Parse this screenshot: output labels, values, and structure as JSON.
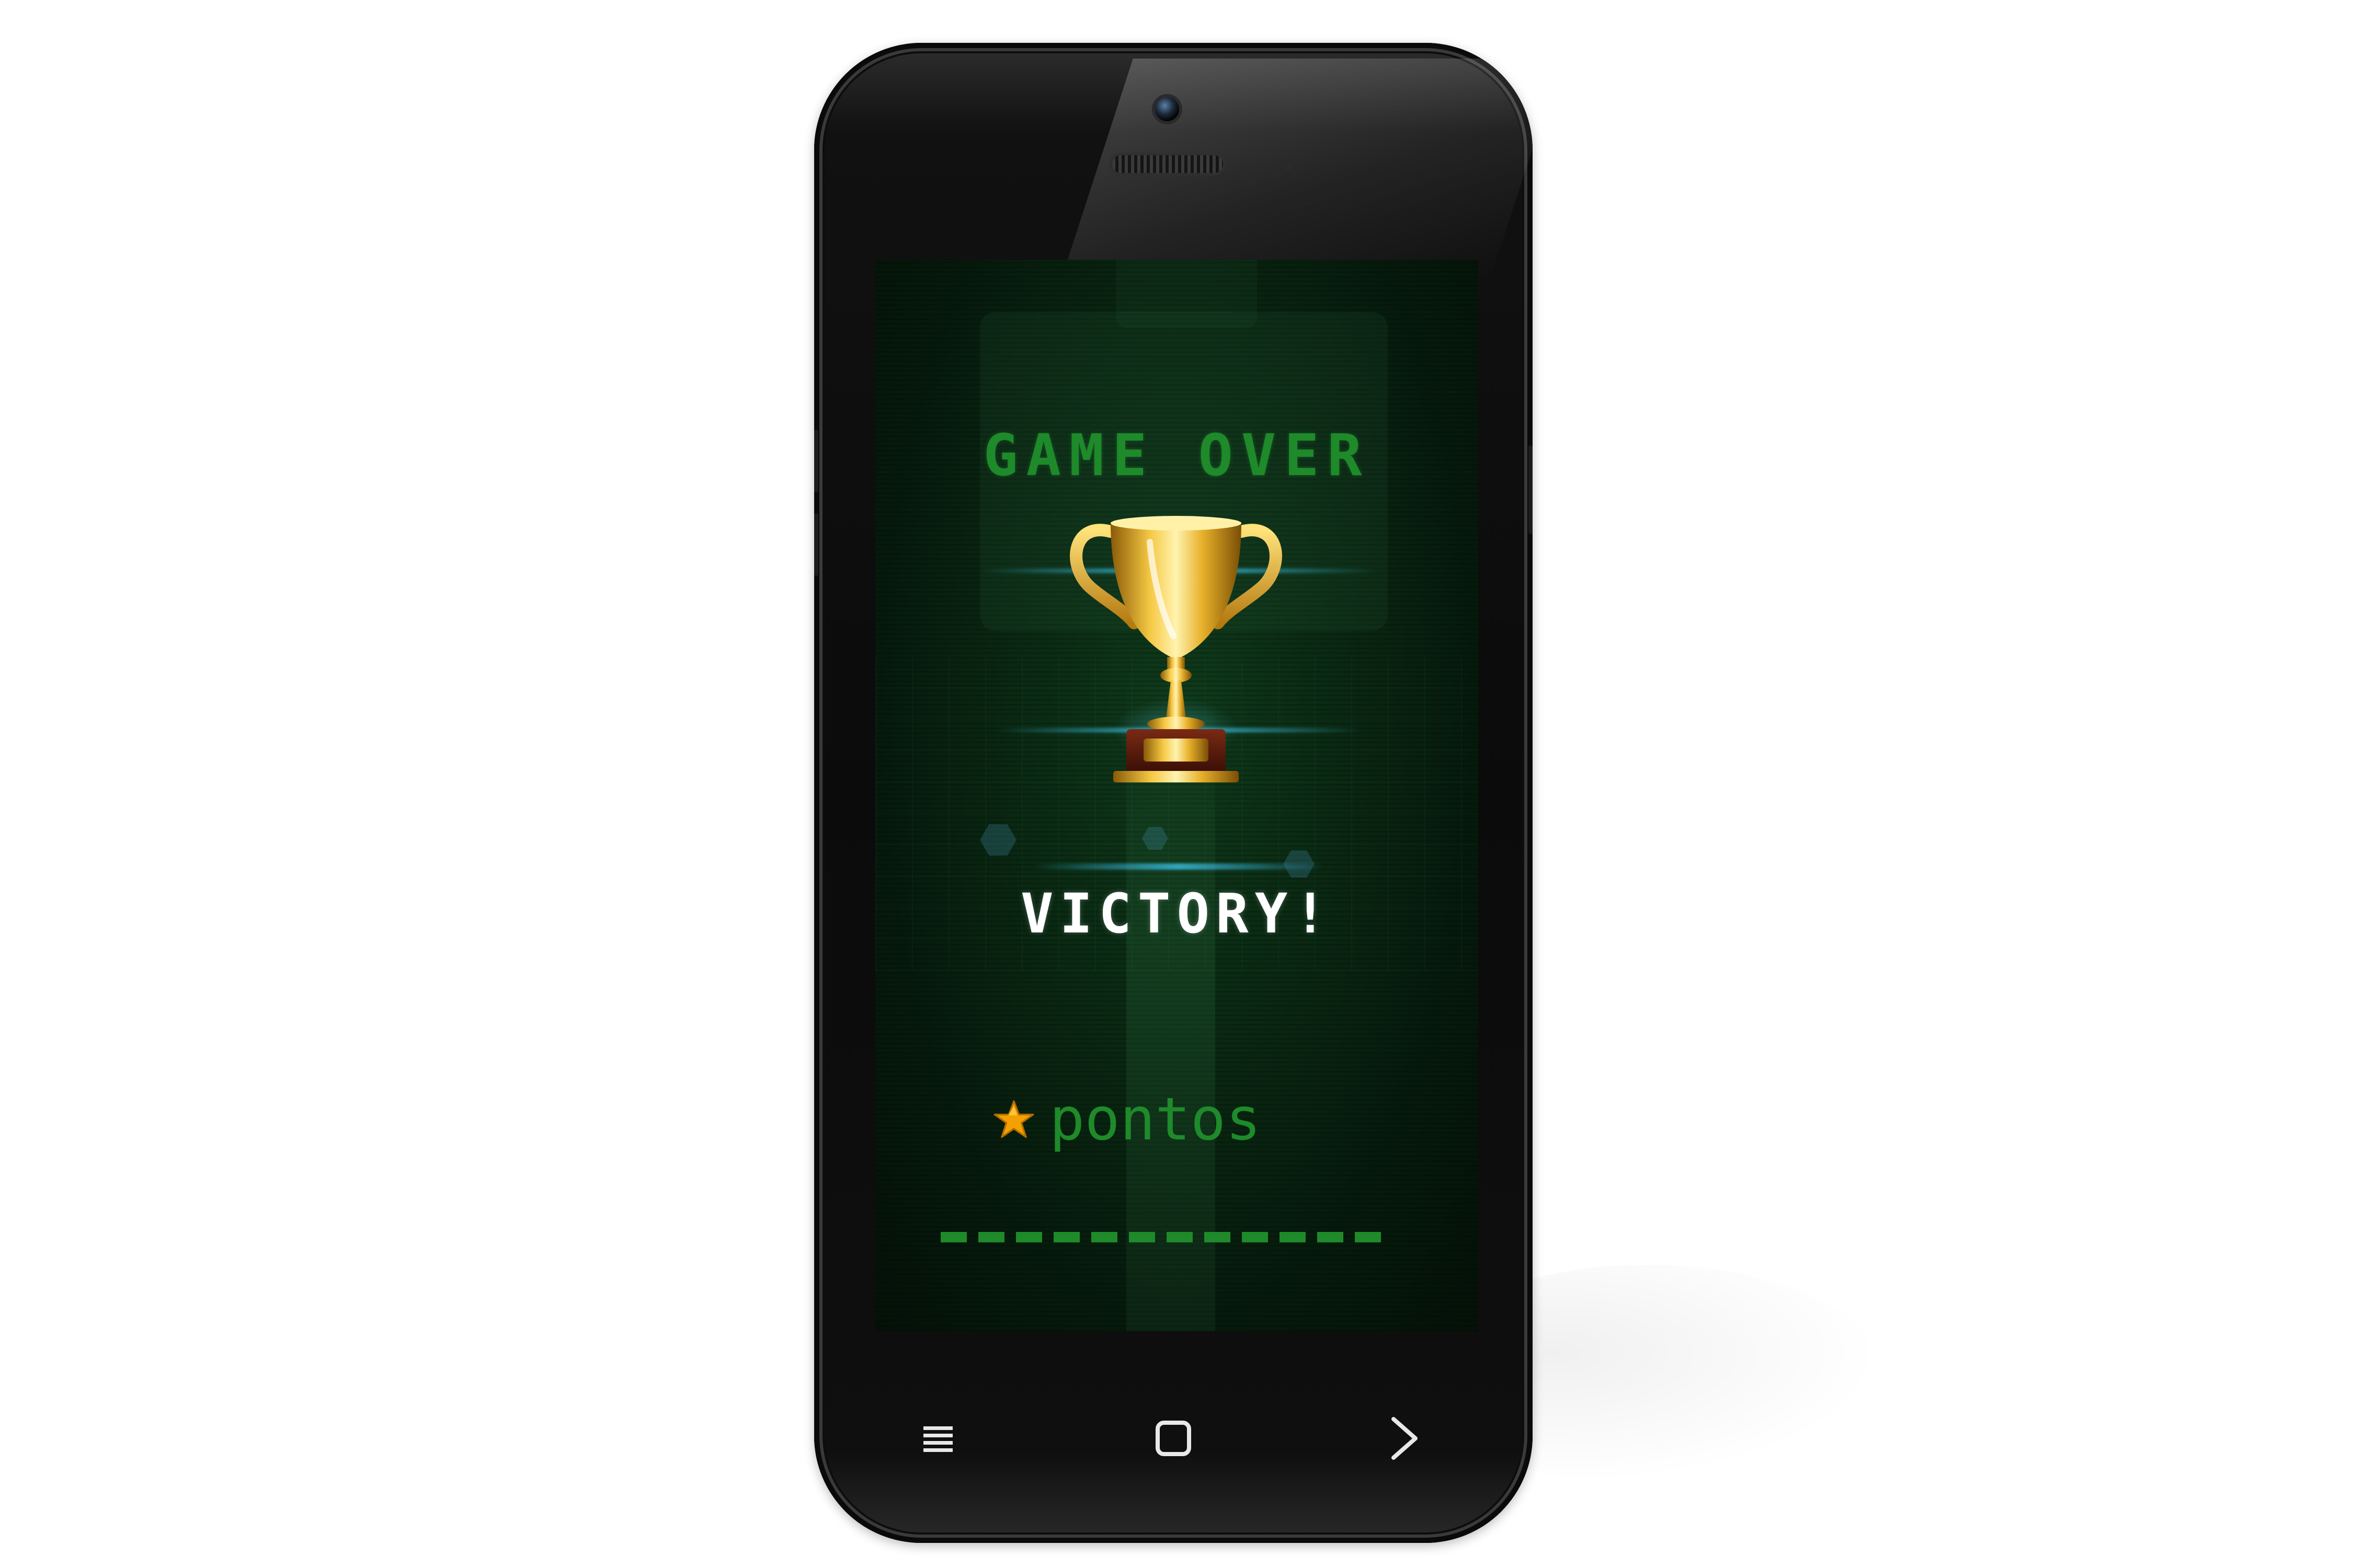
{
  "game": {
    "title": "GAME OVER",
    "result": "VICTORY!",
    "score_label": "pontos"
  },
  "icons": {
    "trophy": "trophy-icon",
    "star": "star-icon",
    "menu": "menu-icon",
    "home": "home-icon",
    "next": "chevron-right-icon"
  },
  "colors": {
    "accent_green": "#1e8a2a",
    "screen_background": "#0a2a13",
    "text_white": "#ffffff",
    "trophy_gold": "#e0a91e",
    "star_orange": "#f2a100"
  }
}
